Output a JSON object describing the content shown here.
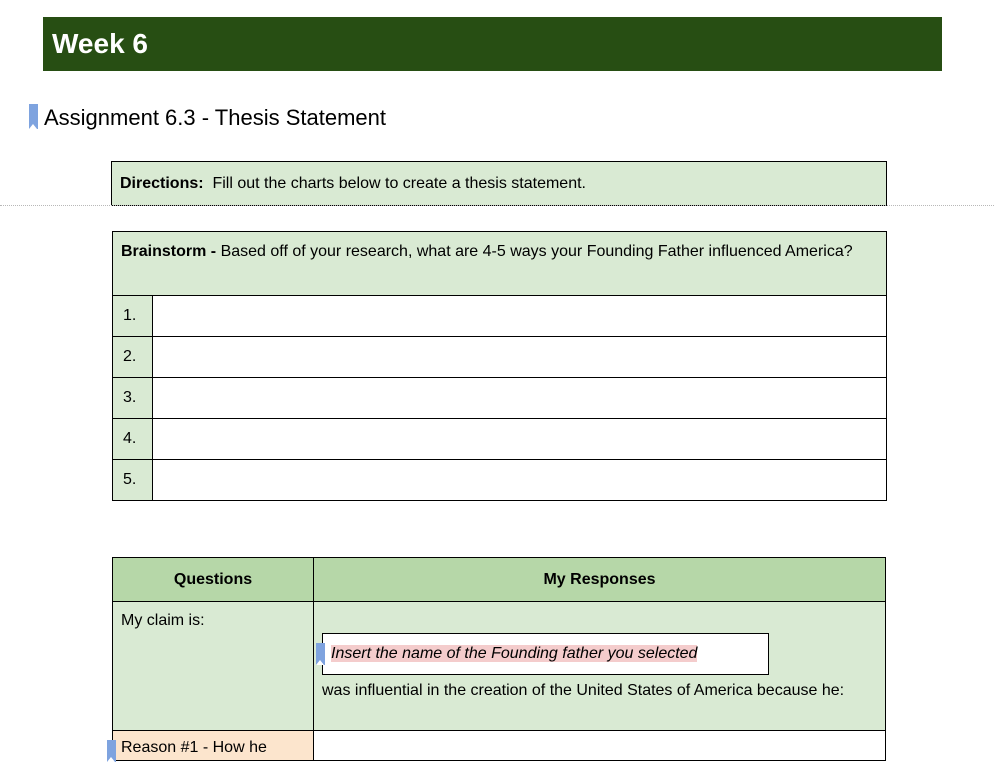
{
  "week": {
    "title": "Week 6"
  },
  "assignment": {
    "title": "Assignment 6.3 - Thesis Statement"
  },
  "directions": {
    "label": "Directions:",
    "text": "Fill out the charts below to create a thesis statement."
  },
  "brainstorm": {
    "label": "Brainstorm -",
    "prompt": "Based off of your research, what are 4-5 ways your Founding Father influenced America?",
    "rows": [
      {
        "number": "1.",
        "value": ""
      },
      {
        "number": "2.",
        "value": ""
      },
      {
        "number": "3.",
        "value": ""
      },
      {
        "number": "4.",
        "value": ""
      },
      {
        "number": "5.",
        "value": ""
      }
    ]
  },
  "claims": {
    "header_questions": "Questions",
    "header_responses": "My Responses",
    "claim_label": "My claim is:",
    "insert_placeholder": "Insert the name of the Founding father you selected",
    "claim_continuation": "was influential in the creation of the United States of America because he:",
    "reason1_label": "Reason #1 - How he"
  },
  "colors": {
    "banner": "#274e13",
    "cell_green": "#d9ead3",
    "header_green": "#b6d7a8",
    "highlight_pink": "#f4cccc",
    "highlight_peach": "#fce5cd",
    "bookmark_blue": "#7ea3df"
  }
}
